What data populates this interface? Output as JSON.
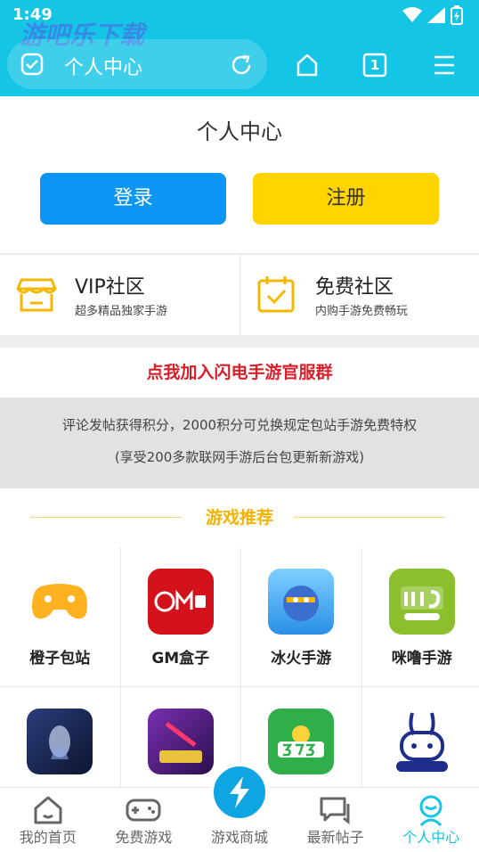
{
  "status": {
    "time": "1:49"
  },
  "watermark": "游吧乐下载",
  "browser": {
    "tab_count": "1",
    "address_title": "个人中心"
  },
  "page_title": "个人中心",
  "auth": {
    "login": "登录",
    "register": "注册"
  },
  "community": [
    {
      "title": "VIP社区",
      "subtitle": "超多精品独家手游"
    },
    {
      "title": "免费社区",
      "subtitle": "内购手游免费畅玩"
    }
  ],
  "join_group": "点我加入闪电手游官服群",
  "points": {
    "line1": "评论发帖获得积分，2000积分可兑换规定包站手游免费特权",
    "line2": "(享受200多款联网手游后台包更新新游戏)"
  },
  "recommend_title": "游戏推荐",
  "games": [
    {
      "name": "橙子包站",
      "icon": "gamepad-orange-icon",
      "color": "#ffb21f"
    },
    {
      "name": "GM盒子",
      "icon": "gm-box-icon",
      "color": "#d4121b"
    },
    {
      "name": "冰火手游",
      "icon": "ice-fire-icon",
      "color": "#2a8fe6"
    },
    {
      "name": "咪噜手游",
      "icon": "milu-icon",
      "color": "#8bbf2c"
    },
    {
      "name": "",
      "icon": "atlantis-icon",
      "color": "#1d2b56"
    },
    {
      "name": "",
      "icon": "jipin-icon",
      "color": "#5b2a8a"
    },
    {
      "name": "",
      "icon": "3733-icon",
      "color": "#2fae4a"
    },
    {
      "name": "",
      "icon": "bunny-icon",
      "color": "#ffffff"
    }
  ],
  "tabs": [
    {
      "label": "我的首页",
      "icon": "home-icon"
    },
    {
      "label": "免费游戏",
      "icon": "gamepad-icon"
    },
    {
      "label": "游戏商城",
      "icon": "lightning-icon"
    },
    {
      "label": "最新帖子",
      "icon": "chat-icon"
    },
    {
      "label": "个人中心",
      "icon": "person-icon"
    }
  ],
  "colors": {
    "accent": "#15c5e6",
    "login": "#0b96f5",
    "register": "#ffd400",
    "highlight": "#d81e2a"
  }
}
